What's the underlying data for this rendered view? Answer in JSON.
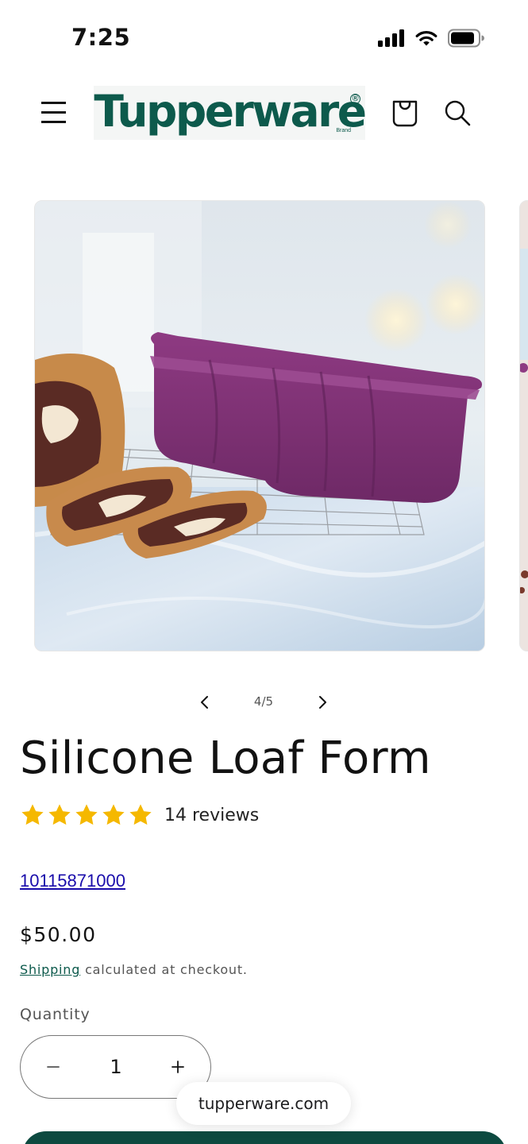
{
  "status_bar": {
    "time": "7:25",
    "icons": [
      "cellular-signal-icon",
      "wifi-icon",
      "battery-icon"
    ]
  },
  "header": {
    "logo_text": "Tupperware",
    "logo_subtext": "Brand",
    "logo_registered": "®",
    "icons": [
      "menu-icon",
      "cart-icon",
      "search-icon"
    ],
    "brand_color": "#0d5a4c"
  },
  "gallery": {
    "current": "4",
    "total": "5",
    "counter_text": "4/5"
  },
  "product": {
    "title": "Silicone Loaf Form",
    "rating": 5,
    "rating_max": 5,
    "reviews_label": "14 reviews",
    "sku": "10115871000",
    "price": "$50.00",
    "shipping_link": "Shipping",
    "shipping_rest": " calculated at checkout.",
    "quantity_label": "Quantity",
    "quantity_value": "1",
    "star_color": "#f5b800"
  },
  "browser": {
    "url": "tupperware.com"
  },
  "colors": {
    "accent": "#0d4a40",
    "link": "#1a0dab"
  }
}
